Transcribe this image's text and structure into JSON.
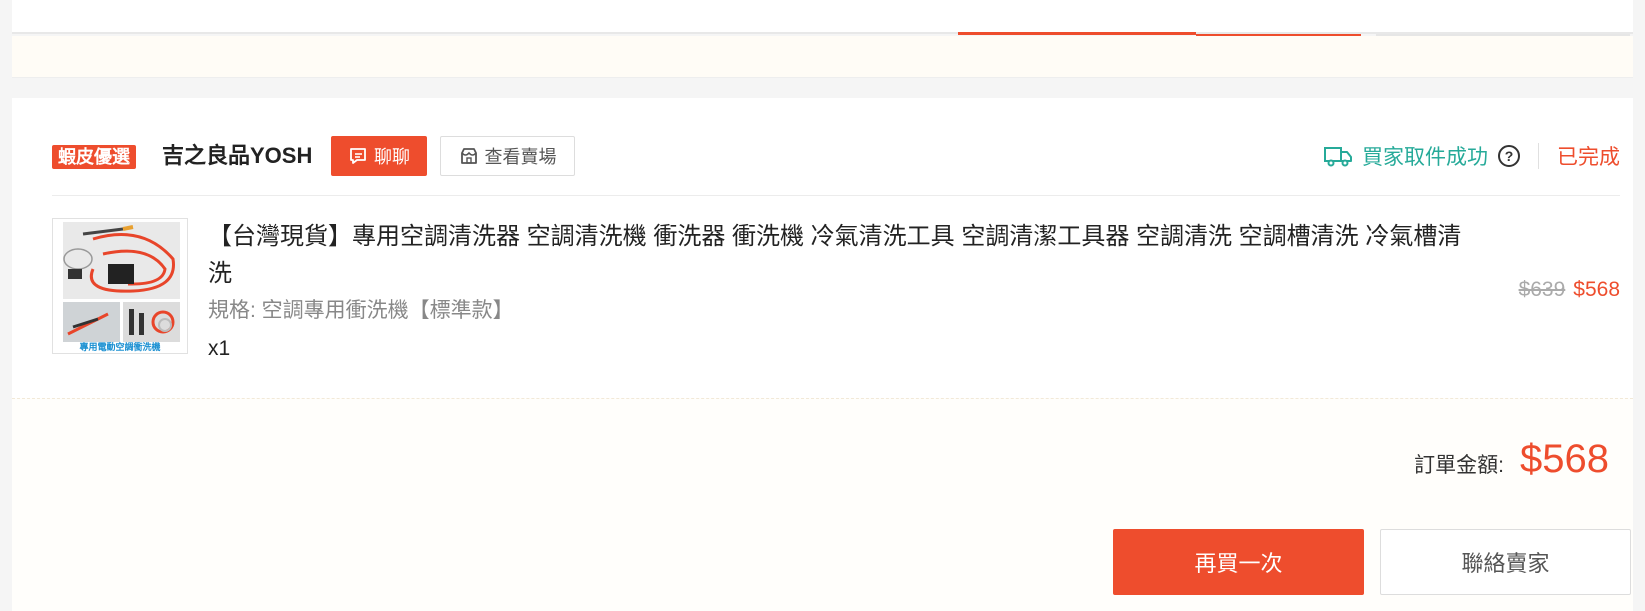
{
  "order": {
    "shop": {
      "badge": "蝦皮優選",
      "name": "吉之良品YOSH",
      "chat_label": "聊聊",
      "view_shop_label": "查看賣場"
    },
    "delivery_status": "買家取件成功",
    "order_status": "已完成",
    "product": {
      "title": "【台灣現貨】專用空調清洗器 空調清洗機 衝洗器 衝洗機 冷氣清洗工具 空調清潔工具器 空調清洗 空調槽清洗 冷氣槽清洗",
      "variation": "規格: 空調專用衝洗機【標準款】",
      "quantity": "x1",
      "thumbnail_caption": "專用電動空調衝洗機",
      "original_price": "$639",
      "price": "$568"
    },
    "total_label": "訂單金額:",
    "total_value": "$568",
    "buy_again_label": "再買一次",
    "contact_seller_label": "聯絡賣家"
  },
  "colors": {
    "accent": "#ee4d2d",
    "teal": "#26aa99",
    "cream": "#fffcf6"
  },
  "icons": [
    "chat-icon",
    "shop-icon",
    "truck-icon",
    "help-icon"
  ]
}
